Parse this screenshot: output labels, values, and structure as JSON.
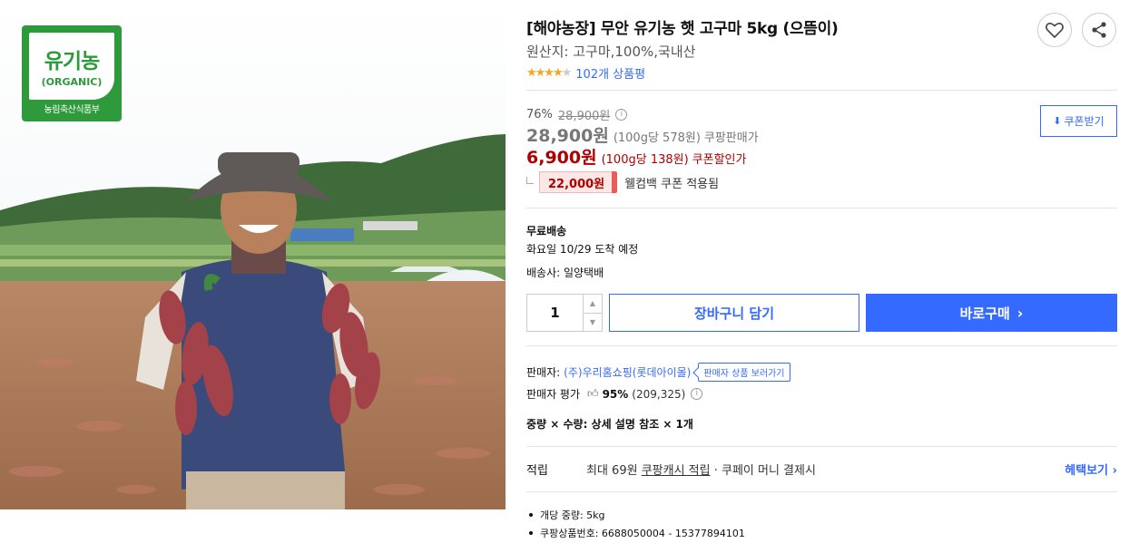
{
  "image": {
    "badge_main": "유기농",
    "badge_sub": "(ORGANIC)",
    "badge_footer": "농림축산식품부"
  },
  "product": {
    "title": "[해야농장] 무안 유기농 햇 고구마 5kg (으뜸이)",
    "origin": "원산지: 고구마,100%,국내산",
    "stars": "★★★★",
    "star_half": "★",
    "review_count": "102개 상품평"
  },
  "price": {
    "discount_rate": "76%",
    "original": "28,900원",
    "info_icon": "i",
    "sale_amount": "28,900원",
    "sale_unit": "(100g당 578원)",
    "sale_label": "쿠팡판매가",
    "coupon_amount": "6,900원",
    "coupon_unit": "(100g당 138원)",
    "coupon_label": "쿠폰할인가",
    "welcome_chip": "22,000원",
    "welcome_note": "웰컴백 쿠폰 적용됨",
    "coupon_button": "쿠폰받기"
  },
  "shipping": {
    "title": "무료배송",
    "arrival": "화요일 10/29 도착 예정",
    "carrier": "배송사: 일양택배"
  },
  "purchase": {
    "quantity": "1",
    "cart_label": "장바구니 담기",
    "buy_label": "바로구매"
  },
  "seller": {
    "label": "판매자:",
    "name": "(주)우리홈쇼핑(롯데아이몰)",
    "tooltip": "판매자 상품 보러가기",
    "eval_label": "판매자 평가",
    "eval_pct": "95%",
    "eval_count": "(209,325)"
  },
  "option": {
    "text": "중량 × 수량: 상세 설명 참조 × 1개"
  },
  "reward": {
    "label": "적립",
    "prefix": "최대 69원 ",
    "cash": "쿠팡캐시 적립",
    "suffix": " · 쿠페이 머니 결제시",
    "benefit": "헤택보기 ›"
  },
  "specs": [
    "개당 중량: 5kg",
    "쿠팡상품번호: 6688050004 - 15377894101"
  ],
  "colors": {
    "accent_blue": "#346aff",
    "price_red": "#ae0000",
    "star": "#f5a623",
    "organic_green": "#2e9a3b"
  }
}
